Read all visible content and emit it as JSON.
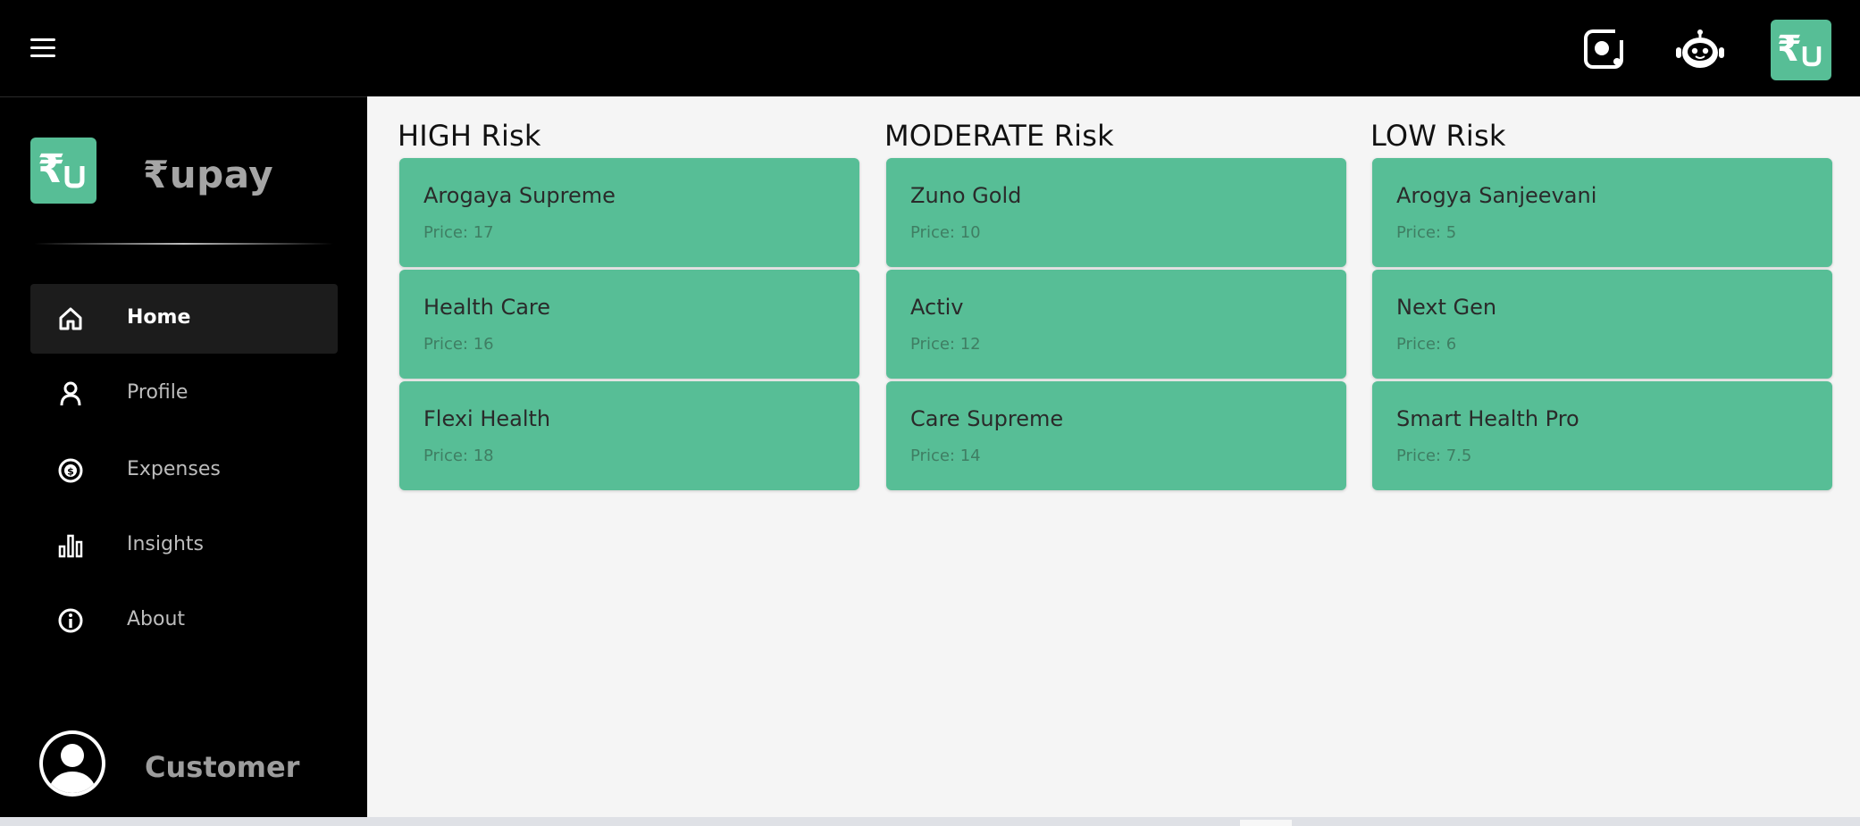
{
  "brand": {
    "name": "₹upay",
    "logo_glyph": "₹U",
    "accent_color": "#57be96"
  },
  "topbar": {
    "menu_icon": "hamburger-icon",
    "icons": [
      "screen-capture-icon",
      "robot-icon"
    ]
  },
  "sidebar": {
    "items": [
      {
        "label": "Home",
        "icon": "home-icon",
        "active": true
      },
      {
        "label": "Profile",
        "icon": "user-icon",
        "active": false
      },
      {
        "label": "Expenses",
        "icon": "dollar-coin-icon",
        "active": false
      },
      {
        "label": "Insights",
        "icon": "bar-chart-icon",
        "active": false
      },
      {
        "label": "About",
        "icon": "info-icon",
        "active": false
      }
    ],
    "user": {
      "name": "Customer"
    }
  },
  "risk_groups": [
    {
      "title": "HIGH Risk",
      "plans": [
        {
          "name": "Arogaya Supreme",
          "price": "Price: 17"
        },
        {
          "name": "Health Care",
          "price": "Price: 16"
        },
        {
          "name": "Flexi Health",
          "price": "Price: 18"
        }
      ]
    },
    {
      "title": "MODERATE Risk",
      "plans": [
        {
          "name": "Zuno Gold",
          "price": "Price: 10"
        },
        {
          "name": "Activ",
          "price": "Price: 12"
        },
        {
          "name": "Care Supreme",
          "price": "Price: 14"
        }
      ]
    },
    {
      "title": "LOW Risk",
      "plans": [
        {
          "name": "Arogya Sanjeevani",
          "price": "Price: 5"
        },
        {
          "name": "Next Gen",
          "price": "Price: 6"
        },
        {
          "name": "Smart Health Pro",
          "price": "Price: 7.5"
        }
      ]
    }
  ]
}
